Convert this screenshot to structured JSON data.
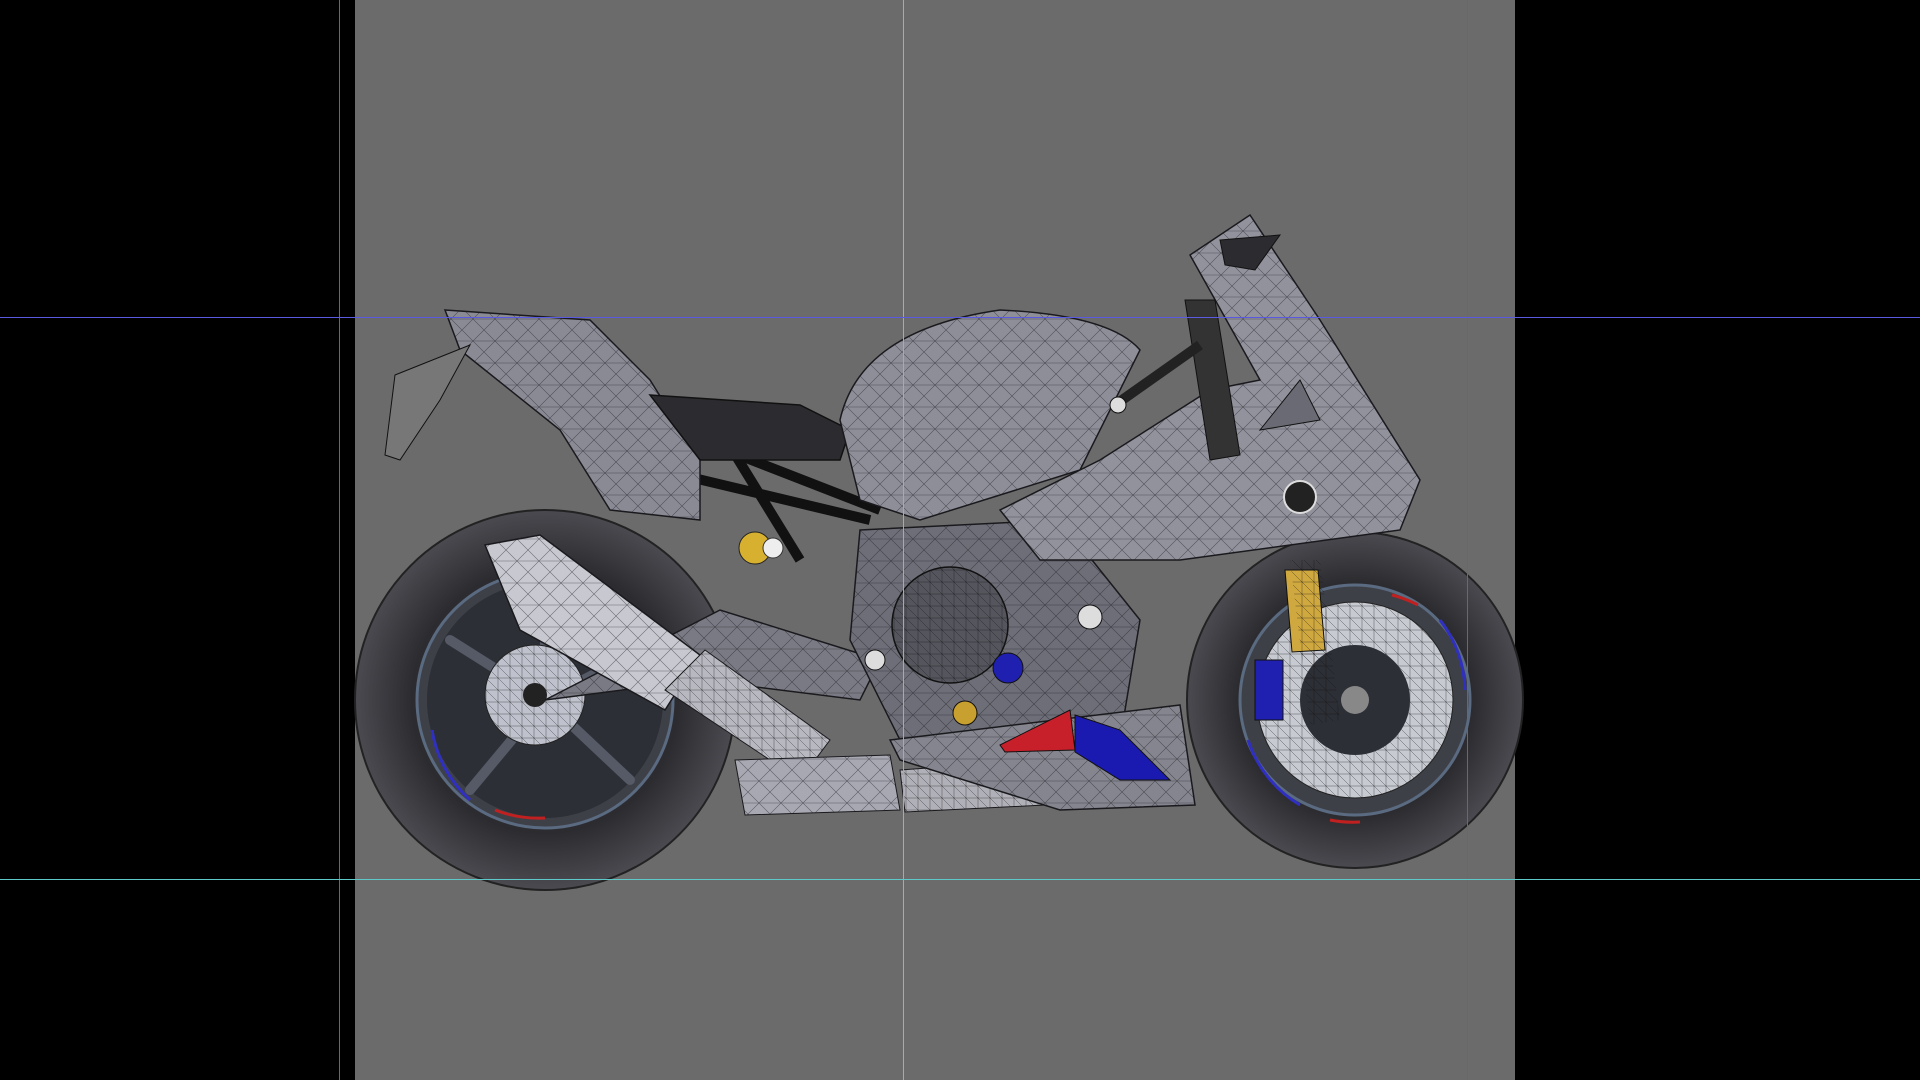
{
  "viewport": {
    "mode": "wireframe-shaded",
    "background_color": "#000000",
    "render_region_color": "#6b6b6b"
  },
  "guides": {
    "horizontal_color": "#5a5ae0",
    "center_color": "#5fc8c8"
  },
  "model": {
    "body_color": "#8a8a95",
    "body_dark": "#55555e",
    "tire_color": "#3a3a3e",
    "wire_color": "#1a1a1e",
    "accent_red": "#c8202a",
    "accent_blue": "#1a1ab0",
    "accent_gold": "#c8a030"
  }
}
